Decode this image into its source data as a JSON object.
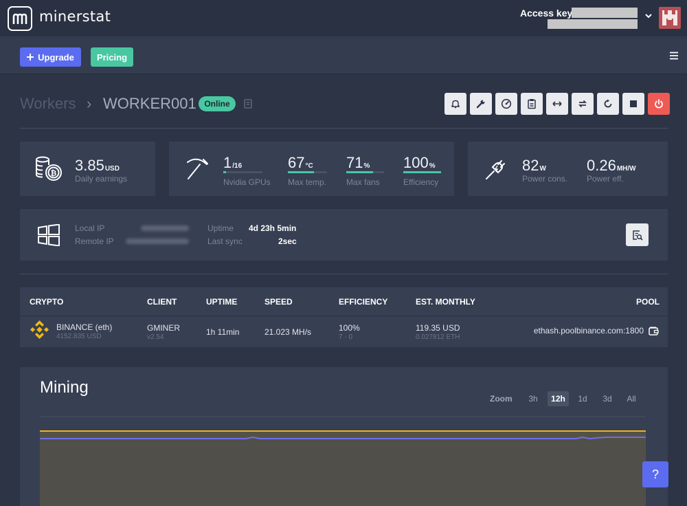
{
  "app": {
    "name": "minerstat"
  },
  "header": {
    "access_key_label": "Access key:"
  },
  "subbar": {
    "upgrade_label": "Upgrade",
    "pricing_label": "Pricing"
  },
  "breadcrumb": {
    "root": "Workers",
    "separator": "›",
    "worker": "WORKER001",
    "status": "Online"
  },
  "actions": [
    "bell-icon",
    "wrench-icon",
    "gauge-icon",
    "clipboard-icon",
    "arrows-horizontal-icon",
    "sync-icon",
    "restart-icon",
    "stop-icon",
    "power-icon"
  ],
  "earnings": {
    "value": "3.85",
    "unit": "USD",
    "label": "Daily earnings"
  },
  "gpus": {
    "count": "1",
    "total": "/16",
    "count_label": "Nvidia GPUs",
    "count_fraction": 0.0625,
    "temp": "67",
    "temp_unit": "°C",
    "temp_label": "Max temp.",
    "temp_fraction": 0.67,
    "fans": "71",
    "fans_unit": "%",
    "fans_label": "Max fans",
    "fans_fraction": 0.71,
    "efficiency": "100",
    "efficiency_unit": "%",
    "efficiency_label": "Efficiency",
    "efficiency_fraction": 1.0
  },
  "power": {
    "value": "82",
    "unit": "W",
    "label": "Power cons.",
    "eff_value": "0.26",
    "eff_unit": "MH/W",
    "eff_label": "Power eff."
  },
  "info": {
    "local_ip_label": "Local IP",
    "remote_ip_label": "Remote IP",
    "uptime_label": "Uptime",
    "uptime_value": "4d 23h 5min",
    "last_sync_label": "Last sync",
    "last_sync_value": "2sec"
  },
  "table": {
    "headers": {
      "crypto": "CRYPTO",
      "client": "CLIENT",
      "uptime": "UPTIME",
      "speed": "SPEED",
      "efficiency": "EFFICIENCY",
      "est_monthly": "EST. MONTHLY",
      "pool": "POOL"
    },
    "rows": [
      {
        "crypto": "BINANCE (eth)",
        "crypto_sub": "4152.835 USD",
        "client": "GMINER",
        "client_sub": "v2.54",
        "uptime": "1h 11min",
        "speed": "21.023 MH/s",
        "efficiency": "100%",
        "efficiency_sub": "7 · 0",
        "monthly": "119.35 USD",
        "monthly_sub": "0.027812 ETH",
        "pool": "ethash.poolbinance.com:1800"
      }
    ]
  },
  "mining": {
    "title": "Mining",
    "zoom_label": "Zoom",
    "zoom_options": [
      "3h",
      "12h",
      "1d",
      "3d",
      "All"
    ],
    "zoom_active": "12h",
    "colors": {
      "primary": "#f0b323",
      "secondary": "#6a6ff0"
    }
  },
  "help": {
    "label": "?"
  }
}
